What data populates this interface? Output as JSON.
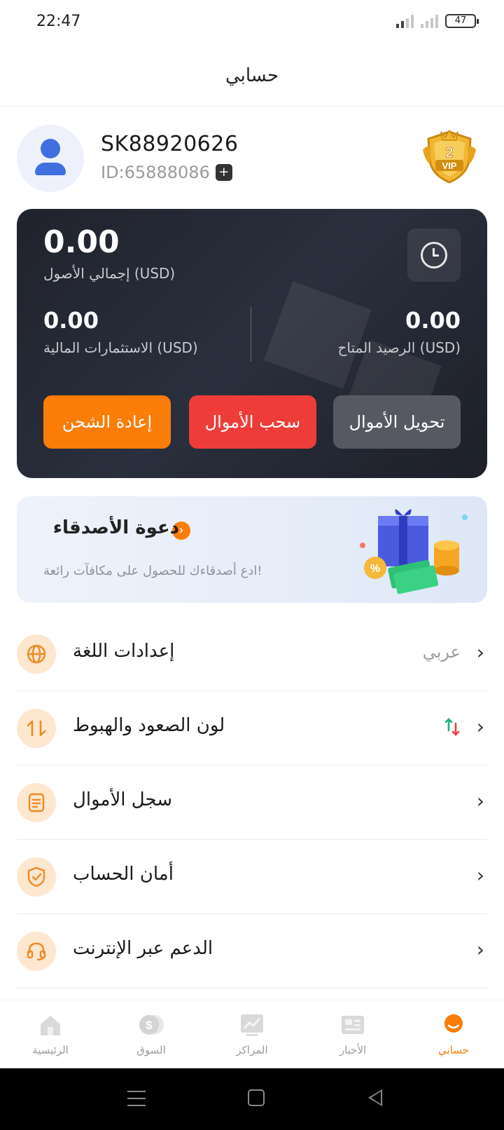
{
  "status_bar": {
    "time": "22:47",
    "battery": "47"
  },
  "header": {
    "title": "حسابي"
  },
  "profile": {
    "username": "SK88920626",
    "user_id": "ID:65888086",
    "vip_level": "2",
    "vip_label": "VIP"
  },
  "assets": {
    "total_value": "0.00",
    "total_label": "إجمالي الأصول  (USD)",
    "financial_value": "0.00",
    "financial_label": "الاستثمارات المالية  (USD)",
    "available_value": "0.00",
    "available_label": "الرصيد المتاح  (USD)",
    "recharge_label": "إعادة الشحن",
    "withdraw_label": "سحب الأموال",
    "transfer_label": "تحويل الأموال"
  },
  "invite": {
    "title": "دعوة الأصدقاء",
    "subtitle": "ادع أصدقاءك للحصول على مكافآت رائعة!"
  },
  "menu": [
    {
      "label": "إعدادات اللغة",
      "value": "عربي",
      "icon": "globe-icon"
    },
    {
      "label": "لون الصعود والهبوط",
      "value": "",
      "icon": "swap-icon"
    },
    {
      "label": "سجل الأموال",
      "value": "",
      "icon": "document-icon"
    },
    {
      "label": "أمان الحساب",
      "value": "",
      "icon": "shield-check-icon"
    },
    {
      "label": "الدعم عبر الإنترنت",
      "value": "",
      "icon": "headset-icon"
    }
  ],
  "bottom_nav": [
    {
      "label": "الرئيسية",
      "icon": "home-icon"
    },
    {
      "label": "السوق",
      "icon": "dollar-icon"
    },
    {
      "label": "المراكز",
      "icon": "chart-icon"
    },
    {
      "label": "الأخبار",
      "icon": "news-icon"
    },
    {
      "label": "حسابي",
      "icon": "profile-icon",
      "active": true
    }
  ],
  "colors": {
    "accent": "#fa7d08",
    "withdraw": "#ee3d39",
    "transfer": "#575962",
    "card_bg": "#232631",
    "up": "#1ab27e",
    "down": "#ee3d39"
  }
}
